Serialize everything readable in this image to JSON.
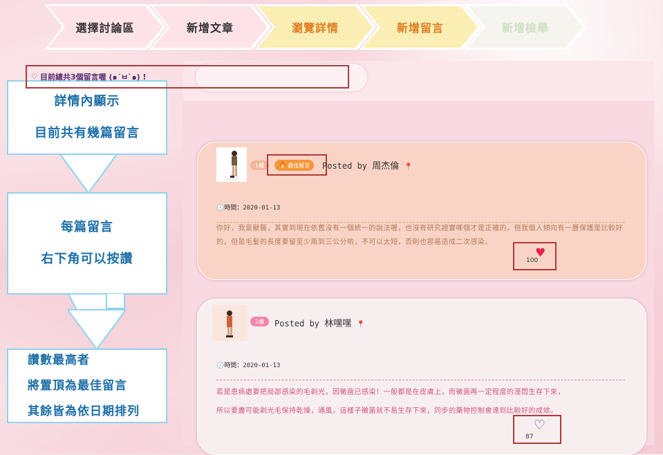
{
  "steps": [
    {
      "label": "選擇討論區"
    },
    {
      "label": "新增文章"
    },
    {
      "label": "瀏覽詳情"
    },
    {
      "label": "新增留言"
    },
    {
      "label": "新增檢舉"
    }
  ],
  "callouts": {
    "box1": [
      "詳情內顯示",
      "目前共有幾篇留言"
    ],
    "box2": [
      "每篇留言",
      "右下角可以按讚"
    ],
    "box3": [
      "讚數最高者",
      "將置頂為最佳留言",
      "其餘皆為依日期排列"
    ]
  },
  "summary": {
    "icon": "heart-outline-icon",
    "text": "目前總共3個留言喔 (๑´ㅂ`๑) !"
  },
  "comments": [
    {
      "floor": "1樓",
      "badge": "最佳留言",
      "badge_icon": "fire-icon",
      "posted_prefix": "Posted by",
      "author": "周杰倫",
      "date_label": "時間：2020-01-13",
      "body": "你好，我是獸醫，其實到現在依舊沒有一個統一的說法喔，也沒有研究證實哪個才是正確的。但我個人傾向有一層保護是比較好的，但是毛髮的長度要留至少兩到三公分喲，不可以太短，否則也容易造成二次感染。",
      "likes": "100",
      "liked": true
    },
    {
      "floor": "2樓",
      "posted_prefix": "Posted by",
      "author": "林嘿嘿",
      "date_label": "時間：2020-01-13",
      "body_lines": [
        "若是患病處要把局部感染的毛剃光，因黴菌已感染！一般都是在皮膚上，而黴菌再一定程度的溼悶生存下來，",
        "所以要盡可能剃光毛保持乾燥，通風，這樣子黴菌就不易生存下來，同步的藥物控制會達到比較好的成效。"
      ],
      "likes": "87",
      "liked": false
    }
  ],
  "colors": {
    "callout_text": "#1d6fa8",
    "callout_border": "#8fd3ef",
    "highlight_border": "#b03a3a",
    "best_badge": "#f5963a",
    "floor_tag_1": "#f2b79a",
    "floor_tag_2": "#f784ab"
  }
}
